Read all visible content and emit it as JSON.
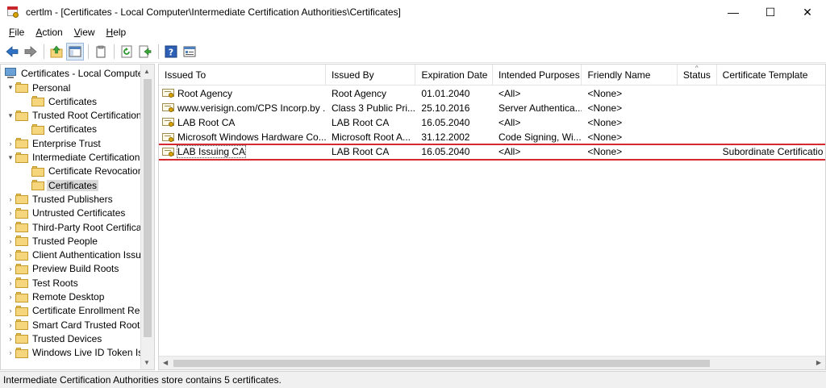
{
  "window": {
    "title": "certlm - [Certificates - Local Computer\\Intermediate Certification Authorities\\Certificates]",
    "minimize_glyph": "—",
    "maximize_glyph": "☐",
    "close_glyph": "✕"
  },
  "menu": [
    {
      "label": "File",
      "accel": "F",
      "rest": "ile"
    },
    {
      "label": "Action",
      "accel": "A",
      "rest": "ction"
    },
    {
      "label": "View",
      "accel": "V",
      "rest": "iew"
    },
    {
      "label": "Help",
      "accel": "H",
      "rest": "elp"
    }
  ],
  "toolbar": {
    "icons": [
      "back-icon",
      "forward-icon",
      "up-folder-icon",
      "show-hide-tree-icon",
      "copy-icon",
      "refresh-icon",
      "export-icon",
      "help-icon",
      "properties-icon"
    ]
  },
  "tree": {
    "root": "Certificates - Local Computer",
    "items": [
      {
        "label": "Personal",
        "level": 1,
        "expander": "expanded"
      },
      {
        "label": "Certificates",
        "level": 2,
        "expander": "none"
      },
      {
        "label": "Trusted Root Certification",
        "level": 1,
        "expander": "expanded"
      },
      {
        "label": "Certificates",
        "level": 2,
        "expander": "none"
      },
      {
        "label": "Enterprise Trust",
        "level": 1,
        "expander": "collapsed"
      },
      {
        "label": "Intermediate Certification",
        "level": 1,
        "expander": "expanded"
      },
      {
        "label": "Certificate Revocation",
        "level": 2,
        "expander": "none"
      },
      {
        "label": "Certificates",
        "level": 2,
        "expander": "none",
        "selected": true
      },
      {
        "label": "Trusted Publishers",
        "level": 1,
        "expander": "collapsed"
      },
      {
        "label": "Untrusted Certificates",
        "level": 1,
        "expander": "collapsed"
      },
      {
        "label": "Third-Party Root Certifica",
        "level": 1,
        "expander": "collapsed"
      },
      {
        "label": "Trusted People",
        "level": 1,
        "expander": "collapsed"
      },
      {
        "label": "Client Authentication Issu",
        "level": 1,
        "expander": "collapsed"
      },
      {
        "label": "Preview Build Roots",
        "level": 1,
        "expander": "collapsed"
      },
      {
        "label": "Test Roots",
        "level": 1,
        "expander": "collapsed"
      },
      {
        "label": "Remote Desktop",
        "level": 1,
        "expander": "collapsed"
      },
      {
        "label": "Certificate Enrollment Rec",
        "level": 1,
        "expander": "collapsed"
      },
      {
        "label": "Smart Card Trusted Roots",
        "level": 1,
        "expander": "collapsed"
      },
      {
        "label": "Trusted Devices",
        "level": 1,
        "expander": "collapsed"
      },
      {
        "label": "Windows Live ID Token Iss",
        "level": 1,
        "expander": "collapsed"
      }
    ]
  },
  "table": {
    "columns": [
      "Issued To",
      "Issued By",
      "Expiration Date",
      "Intended Purposes",
      "Friendly Name",
      "Status",
      "Certificate Template"
    ],
    "rows": [
      [
        "Root Agency",
        "Root Agency",
        "01.01.2040",
        "<All>",
        "<None>",
        "",
        ""
      ],
      [
        "www.verisign.com/CPS Incorp.by ...",
        "Class 3 Public Pri...",
        "25.10.2016",
        "Server Authentica...",
        "<None>",
        "",
        ""
      ],
      [
        "LAB Root CA",
        "LAB Root CA",
        "16.05.2040",
        "<All>",
        "<None>",
        "",
        ""
      ],
      [
        "Microsoft Windows Hardware Co...",
        "Microsoft Root A...",
        "31.12.2002",
        "Code Signing, Wi...",
        "<None>",
        "",
        ""
      ],
      [
        "LAB Issuing CA",
        "LAB Root CA",
        "16.05.2040",
        "<All>",
        "<None>",
        "",
        "Subordinate Certificatio"
      ]
    ],
    "highlighted_row": 4,
    "highlight_color": "#d6282f"
  },
  "status": {
    "text": "Intermediate Certification Authorities store contains 5 certificates."
  }
}
